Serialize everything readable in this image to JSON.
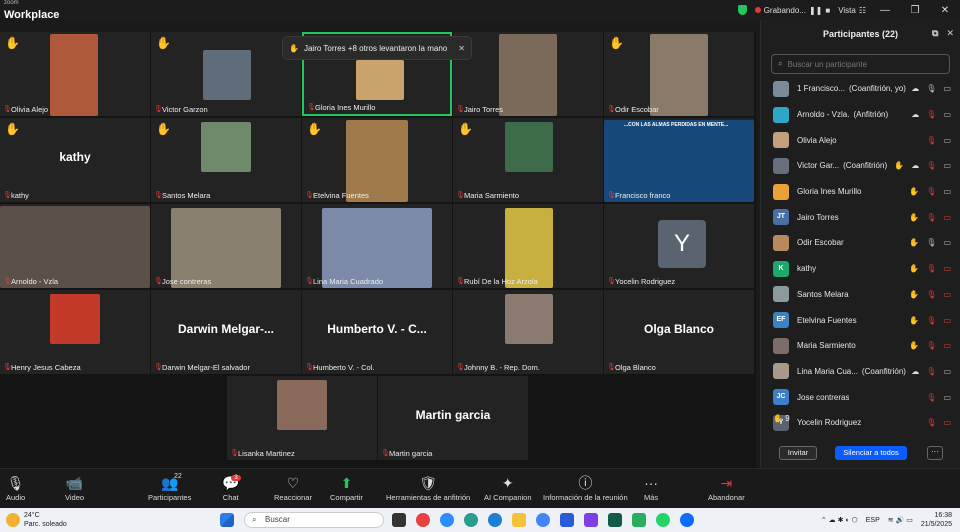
{
  "app": {
    "brand_small": "zoom",
    "brand": "Workplace",
    "recording": "Grabando...",
    "view": "Vista"
  },
  "toast": {
    "text": "Jairo Torres +8 otros levantaron la mano"
  },
  "tiles": [
    {
      "name": "Olivia Alejo",
      "hand": true
    },
    {
      "name": "Victor Garzon",
      "hand": true
    },
    {
      "name": "Gloria Ines Murillo",
      "hand": false
    },
    {
      "name": "Jairo Torres",
      "hand": false
    },
    {
      "name": "Odir Escobar",
      "hand": true
    },
    {
      "name": "kathy",
      "display": "kathy",
      "hand": true
    },
    {
      "name": "Santos Melara",
      "hand": true
    },
    {
      "name": "Etelvina Fuentes",
      "hand": true
    },
    {
      "name": "Maria Sarmiento",
      "hand": true
    },
    {
      "name": "Francisco franco",
      "hand": false,
      "slide": "...CON LAS ALMAS PERDIDAS EN MENTE..."
    },
    {
      "name": "Arnoldo - Vzla",
      "hand": false
    },
    {
      "name": "Jose contreras",
      "hand": false
    },
    {
      "name": "Lina Maria Cuadrado",
      "hand": false
    },
    {
      "name": "Rubí De la Hoz Arzola",
      "hand": false
    },
    {
      "name": "Yocelin Rodriguez",
      "hand": false,
      "avatar": "Y"
    },
    {
      "name": "Henry Jesus Cabeza",
      "hand": false
    },
    {
      "name": "Darwin Melgar-El salvador",
      "display": "Darwin  Melgar-...",
      "hand": false
    },
    {
      "name": "Humberto V. - Col.",
      "display": "Humberto V. - C...",
      "hand": false
    },
    {
      "name": "Johnny B. - Rep. Dom.",
      "hand": false
    },
    {
      "name": "Olga Blanco",
      "display": "Olga Blanco",
      "hand": false
    },
    {
      "name": "Lisanka Martinez",
      "hand": false
    },
    {
      "name": "Martin garcia",
      "display": "Martin garcia",
      "hand": false
    }
  ],
  "panel": {
    "title": "Participantes (22)",
    "search_placeholder": "Buscar un participante",
    "participants": [
      {
        "name": "1 Francisco...",
        "role": "(Coanfitrión, yo)",
        "initials": "",
        "color": "#7a8a99",
        "hand": false,
        "cloud": true,
        "mic": "on",
        "cam": "on"
      },
      {
        "name": "Arnoldo - Vzla.",
        "role": "(Anfitrión)",
        "initials": "",
        "color": "#2ea7c6",
        "hand": false,
        "cloud": true,
        "mic": "off",
        "cam": "on"
      },
      {
        "name": "Olivia Alejo",
        "role": "",
        "initials": "",
        "color": "#c4a07a",
        "hand": false,
        "cloud": false,
        "mic": "off",
        "cam": "on"
      },
      {
        "name": "Victor Gar...",
        "role": "(Coanfitrión)",
        "initials": "",
        "color": "#66707a",
        "hand": true,
        "cloud": true,
        "mic": "off",
        "cam": "on"
      },
      {
        "name": "Gloria Ines Murillo",
        "role": "",
        "initials": "",
        "color": "#e8a23a",
        "hand": true,
        "cloud": false,
        "mic": "off",
        "cam": "on"
      },
      {
        "name": "Jairo Torres",
        "role": "",
        "initials": "JT",
        "color": "#4a6fa5",
        "hand": true,
        "cloud": false,
        "mic": "off",
        "cam": "off"
      },
      {
        "name": "Odir Escobar",
        "role": "",
        "initials": "",
        "color": "#b68a5e",
        "hand": true,
        "cloud": false,
        "mic": "on",
        "cam": "on"
      },
      {
        "name": "kathy",
        "role": "",
        "initials": "K",
        "color": "#1fa86b",
        "hand": true,
        "cloud": false,
        "mic": "off",
        "cam": "off"
      },
      {
        "name": "Santos Melara",
        "role": "",
        "initials": "",
        "color": "#8a9aa0",
        "hand": true,
        "cloud": false,
        "mic": "off",
        "cam": "off"
      },
      {
        "name": "Etelvina Fuentes",
        "role": "",
        "initials": "EF",
        "color": "#3b82c4",
        "hand": true,
        "cloud": false,
        "mic": "off",
        "cam": "off"
      },
      {
        "name": "Maria Sarmiento",
        "role": "",
        "initials": "",
        "color": "#7c6e66",
        "hand": true,
        "cloud": false,
        "mic": "off",
        "cam": "off"
      },
      {
        "name": "Lina Maria Cua...",
        "role": "(Coanfitrión)",
        "initials": "",
        "color": "#a89a8a",
        "hand": false,
        "cloud": true,
        "mic": "off",
        "cam": "on"
      },
      {
        "name": "Jose contreras",
        "role": "",
        "initials": "JC",
        "color": "#3d7fc9",
        "hand": false,
        "cloud": false,
        "mic": "off",
        "cam": "on"
      },
      {
        "name": "Yocelin Rodriguez",
        "role": "",
        "initials": "Y",
        "color": "#5a6470",
        "hand": false,
        "cloud": false,
        "mic": "off",
        "cam": "off"
      }
    ],
    "hand_count": "9",
    "invite": "Invitar",
    "mute_all": "Silenciar a todos",
    "more": "···"
  },
  "toolbar": [
    {
      "label": "Audio",
      "icon": "🎙"
    },
    {
      "label": "Video",
      "icon": "📹"
    },
    {
      "label": "Participantes",
      "icon": "👥",
      "count": "22"
    },
    {
      "label": "Chat",
      "icon": "💬",
      "badge": "3"
    },
    {
      "label": "Reaccionar",
      "icon": "♡"
    },
    {
      "label": "Compartir",
      "icon": "⬆"
    },
    {
      "label": "Herramientas de anfitrión",
      "icon": "🛡"
    },
    {
      "label": "AI Companion",
      "icon": "✦"
    },
    {
      "label": "Información de la reunión",
      "icon": "ⓘ"
    },
    {
      "label": "Más",
      "icon": "···"
    },
    {
      "label": "Abandonar",
      "icon": "⇥"
    }
  ],
  "taskbar": {
    "temp": "24°C",
    "weather": "Parc. soleado",
    "search": "Buscar",
    "lang": "ESP",
    "time": "16:38",
    "date": "21/5/2025"
  }
}
